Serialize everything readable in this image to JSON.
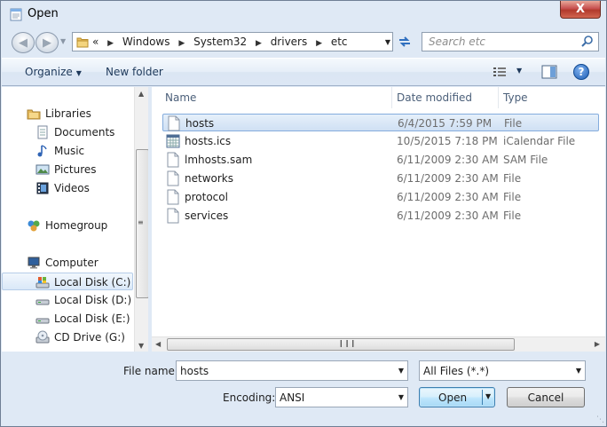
{
  "window": {
    "title": "Open",
    "close_label": "X"
  },
  "nav": {
    "back_icon": "back-arrow-icon",
    "forward_icon": "forward-arrow-icon",
    "breadcrumb": [
      {
        "label": "«"
      },
      {
        "label": "Windows"
      },
      {
        "label": "System32"
      },
      {
        "label": "drivers"
      },
      {
        "label": "etc"
      }
    ],
    "search_placeholder": "Search etc"
  },
  "toolbar": {
    "organize": "Organize",
    "new_folder": "New folder",
    "help": "?"
  },
  "sidebar": {
    "items": [
      {
        "label": "Libraries",
        "icon": "libraries-icon"
      },
      {
        "label": "Documents",
        "icon": "documents-icon"
      },
      {
        "label": "Music",
        "icon": "music-icon"
      },
      {
        "label": "Pictures",
        "icon": "pictures-icon"
      },
      {
        "label": "Videos",
        "icon": "videos-icon"
      },
      {
        "label": "Homegroup",
        "icon": "homegroup-icon"
      },
      {
        "label": "Computer",
        "icon": "computer-icon"
      },
      {
        "label": "Local Disk (C:)",
        "icon": "local-disk-c-icon",
        "selected": true
      },
      {
        "label": "Local Disk (D:)",
        "icon": "local-disk-icon"
      },
      {
        "label": "Local Disk (E:)",
        "icon": "local-disk-icon"
      },
      {
        "label": "CD Drive (G:)",
        "icon": "cd-drive-icon"
      }
    ]
  },
  "filelist": {
    "columns": [
      "Name",
      "Date modified",
      "Type"
    ],
    "rows": [
      {
        "name": "hosts",
        "date": "6/4/2015 7:59 PM",
        "type": "File",
        "selected": true
      },
      {
        "name": "hosts.ics",
        "date": "10/5/2015 7:18 PM",
        "type": "iCalendar File"
      },
      {
        "name": "lmhosts.sam",
        "date": "6/11/2009 2:30 AM",
        "type": "SAM File"
      },
      {
        "name": "networks",
        "date": "6/11/2009 2:30 AM",
        "type": "File"
      },
      {
        "name": "protocol",
        "date": "6/11/2009 2:30 AM",
        "type": "File"
      },
      {
        "name": "services",
        "date": "6/11/2009 2:30 AM",
        "type": "File"
      }
    ]
  },
  "bottom": {
    "filename_label": "File name:",
    "filename_value": "hosts",
    "filter_value": "All Files  (*.*)",
    "encoding_label": "Encoding:",
    "encoding_value": "ANSI",
    "open_label": "Open",
    "cancel_label": "Cancel"
  }
}
